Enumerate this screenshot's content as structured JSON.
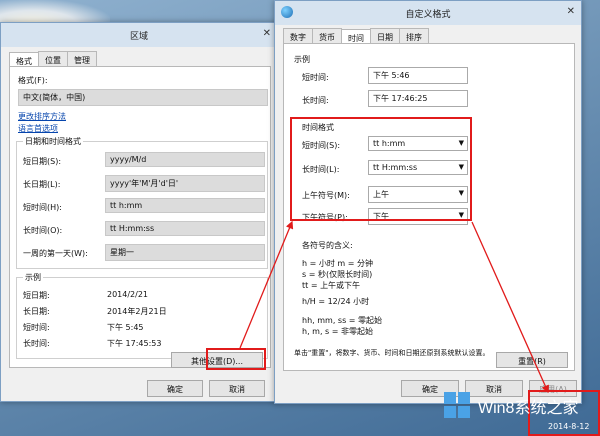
{
  "left_window": {
    "title": "区域",
    "close_glyph": "✕",
    "tabs": [
      "格式",
      "位置",
      "管理"
    ],
    "format_label": "格式(F):",
    "format_value": "中文(简体，中国)",
    "link_sort": "更改排序方法",
    "link_lang": "语言首选项",
    "datetime_group": "日期和时间格式",
    "rows": [
      {
        "label": "短日期(S):",
        "value": "yyyy/M/d"
      },
      {
        "label": "长日期(L):",
        "value": "yyyy'年'M'月'd'日'"
      },
      {
        "label": "短时间(H):",
        "value": "tt h:mm"
      },
      {
        "label": "长时间(O):",
        "value": "tt H:mm:ss"
      },
      {
        "label": "一周的第一天(W):",
        "value": "星期一"
      }
    ],
    "example_group": "示例",
    "examples": [
      {
        "label": "短日期:",
        "value": "2014/2/21"
      },
      {
        "label": "长日期:",
        "value": "2014年2月21日"
      },
      {
        "label": "短时间:",
        "value": "下午 5:45"
      },
      {
        "label": "长时间:",
        "value": "下午 17:45:53"
      }
    ],
    "other_settings": "其他设置(D)...",
    "ok": "确定",
    "cancel": "取消"
  },
  "right_window": {
    "title": "自定义格式",
    "close_glyph": "✕",
    "tabs": [
      "数字",
      "货币",
      "时间",
      "日期",
      "排序"
    ],
    "example_group": "示例",
    "examples": [
      {
        "label": "短时间:",
        "value": "下午 5:46"
      },
      {
        "label": "长时间:",
        "value": "下午 17:46:25"
      }
    ],
    "time_group": "时间格式",
    "time_rows": [
      {
        "label": "短时间(S):",
        "value": "tt h:mm"
      },
      {
        "label": "长时间(L):",
        "value": "tt H:mm:ss"
      },
      {
        "label": "上午符号(M):",
        "value": "上午"
      },
      {
        "label": "下午符号(P):",
        "value": "下午"
      }
    ],
    "meaning_title": "各符号的含义:",
    "meaning_lines": [
      "h = 小时   m = 分钟",
      "s = 秒(仅限长时间)",
      "tt = 上午或下午",
      "h/H = 12/24 小时",
      "hh, mm, ss = 零起始",
      "h, m, s = 非零起始"
    ],
    "reset_note": "单击\"重置\"，将数字、货币、时间和日期还原到系统默认设置。",
    "reset": "重置(R)",
    "ok": "确定",
    "cancel": "取消",
    "apply": "应用(A)"
  },
  "taskbar": {
    "logo_text": "Win8系统之家",
    "date": "2014-8-12"
  },
  "colors": {
    "highlight": "#e11b1b",
    "link": "#0645ad",
    "titlebar": "#d6e3f0"
  }
}
